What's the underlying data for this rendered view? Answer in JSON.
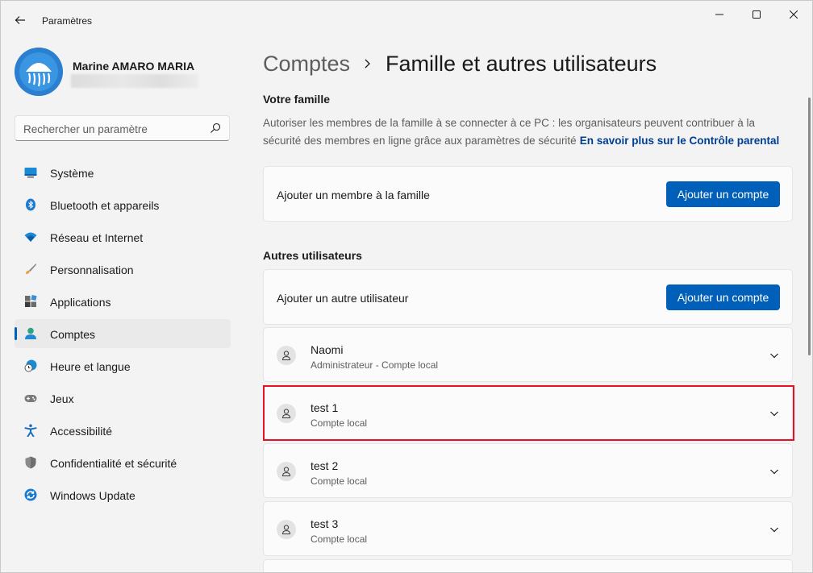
{
  "window": {
    "title": "Paramètres"
  },
  "user": {
    "name": "Marine AMARO MARIA"
  },
  "search": {
    "placeholder": "Rechercher un paramètre"
  },
  "sidebar": {
    "items": [
      {
        "label": "Système",
        "icon": "system-icon"
      },
      {
        "label": "Bluetooth et appareils",
        "icon": "bluetooth-icon"
      },
      {
        "label": "Réseau et Internet",
        "icon": "wifi-icon"
      },
      {
        "label": "Personnalisation",
        "icon": "brush-icon"
      },
      {
        "label": "Applications",
        "icon": "apps-icon"
      },
      {
        "label": "Comptes",
        "icon": "account-icon"
      },
      {
        "label": "Heure et langue",
        "icon": "clock-globe-icon"
      },
      {
        "label": "Jeux",
        "icon": "gamepad-icon"
      },
      {
        "label": "Accessibilité",
        "icon": "accessibility-icon"
      },
      {
        "label": "Confidentialité et sécurité",
        "icon": "shield-icon"
      },
      {
        "label": "Windows Update",
        "icon": "windows-update-icon"
      }
    ],
    "active_index": 5
  },
  "breadcrumb": {
    "parent": "Comptes",
    "current": "Famille et autres utilisateurs"
  },
  "family": {
    "title": "Votre famille",
    "description": "Autoriser les membres de la famille à se connecter à ce PC : les organisateurs peuvent contribuer à la sécurité des membres en ligne grâce aux paramètres de sécurité",
    "link": "En savoir plus sur le Contrôle parental",
    "add_label": "Ajouter un membre à la famille",
    "add_button": "Ajouter un compte"
  },
  "others": {
    "title": "Autres utilisateurs",
    "add_label": "Ajouter un autre utilisateur",
    "add_button": "Ajouter un compte",
    "users": [
      {
        "name": "Naomi",
        "type": "Administrateur - Compte local"
      },
      {
        "name": "test 1",
        "type": "Compte local"
      },
      {
        "name": "test 2",
        "type": "Compte local"
      },
      {
        "name": "test 3",
        "type": "Compte local"
      }
    ],
    "highlighted_index": 1
  },
  "colors": {
    "accent": "#005fb8",
    "highlight": "#e81123",
    "link": "#003e92"
  }
}
